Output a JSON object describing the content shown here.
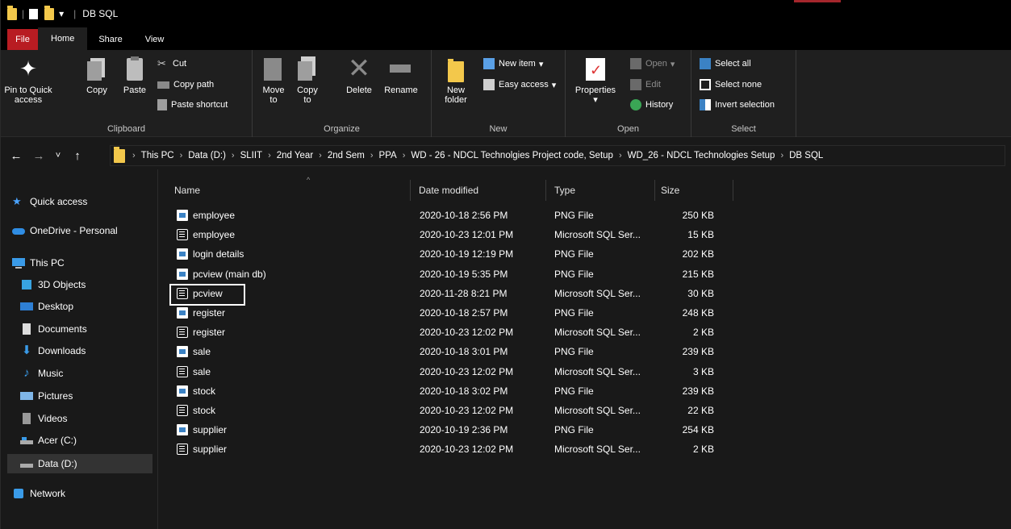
{
  "window": {
    "title": "DB SQL"
  },
  "tabs": [
    {
      "label": "File"
    },
    {
      "label": "Home"
    },
    {
      "label": "Share"
    },
    {
      "label": "View"
    }
  ],
  "ribbon": {
    "clipboard": {
      "label": "Clipboard",
      "pin": "Pin to Quick access",
      "copy": "Copy",
      "paste": "Paste",
      "cut": "Cut",
      "copy_path": "Copy path",
      "paste_shortcut": "Paste shortcut"
    },
    "organize": {
      "label": "Organize",
      "move_to": "Move to",
      "copy_to": "Copy to",
      "delete": "Delete",
      "rename": "Rename"
    },
    "new": {
      "label": "New",
      "new_folder": "New folder",
      "new_item": "New item",
      "easy_access": "Easy access"
    },
    "open": {
      "label": "Open",
      "properties": "Properties",
      "open": "Open",
      "edit": "Edit",
      "history": "History"
    },
    "select": {
      "label": "Select",
      "select_all": "Select all",
      "select_none": "Select none",
      "invert": "Invert selection"
    }
  },
  "address": {
    "crumbs": [
      "This PC",
      "Data (D:)",
      "SLIIT",
      "2nd Year",
      "2nd Sem",
      "PPA",
      "WD - 26 - NDCL Technolgies Project code, Setup",
      "WD_26 - NDCL Technologies Setup",
      "DB SQL"
    ]
  },
  "nav": [
    {
      "label": "Quick access",
      "icon": "star-icon"
    },
    {
      "label": "OneDrive - Personal",
      "icon": "cloud-icon"
    },
    {
      "label": "This PC",
      "icon": "computer-icon"
    },
    {
      "label": "3D Objects",
      "icon": "cube-icon"
    },
    {
      "label": "Desktop",
      "icon": "desktop-icon"
    },
    {
      "label": "Documents",
      "icon": "document-icon"
    },
    {
      "label": "Downloads",
      "icon": "download-icon"
    },
    {
      "label": "Music",
      "icon": "music-icon"
    },
    {
      "label": "Pictures",
      "icon": "pictures-icon"
    },
    {
      "label": "Videos",
      "icon": "video-icon"
    },
    {
      "label": "Acer (C:)",
      "icon": "drive-icon"
    },
    {
      "label": "Data (D:)",
      "icon": "drive-icon"
    },
    {
      "label": "Network",
      "icon": "network-icon"
    }
  ],
  "columns": {
    "name": "Name",
    "date": "Date modified",
    "type": "Type",
    "size": "Size"
  },
  "files": [
    {
      "name": "employee",
      "date": "2020-10-18 2:56 PM",
      "type": "PNG File",
      "size": "250 KB",
      "kind": "png"
    },
    {
      "name": "employee",
      "date": "2020-10-23 12:01 PM",
      "type": "Microsoft SQL Ser...",
      "size": "15 KB",
      "kind": "sql"
    },
    {
      "name": "login details",
      "date": "2020-10-19 12:19 PM",
      "type": "PNG File",
      "size": "202 KB",
      "kind": "png"
    },
    {
      "name": "pcview (main db)",
      "date": "2020-10-19 5:35 PM",
      "type": "PNG File",
      "size": "215 KB",
      "kind": "png"
    },
    {
      "name": "pcview",
      "date": "2020-11-28 8:21 PM",
      "type": "Microsoft SQL Ser...",
      "size": "30 KB",
      "kind": "sql"
    },
    {
      "name": "register",
      "date": "2020-10-18 2:57 PM",
      "type": "PNG File",
      "size": "248 KB",
      "kind": "png"
    },
    {
      "name": "register",
      "date": "2020-10-23 12:02 PM",
      "type": "Microsoft SQL Ser...",
      "size": "2 KB",
      "kind": "sql"
    },
    {
      "name": "sale",
      "date": "2020-10-18 3:01 PM",
      "type": "PNG File",
      "size": "239 KB",
      "kind": "png"
    },
    {
      "name": "sale",
      "date": "2020-10-23 12:02 PM",
      "type": "Microsoft SQL Ser...",
      "size": "3 KB",
      "kind": "sql"
    },
    {
      "name": "stock",
      "date": "2020-10-18 3:02 PM",
      "type": "PNG File",
      "size": "239 KB",
      "kind": "png"
    },
    {
      "name": "stock",
      "date": "2020-10-23 12:02 PM",
      "type": "Microsoft SQL Ser...",
      "size": "22 KB",
      "kind": "sql"
    },
    {
      "name": "supplier",
      "date": "2020-10-19 2:36 PM",
      "type": "PNG File",
      "size": "254 KB",
      "kind": "png"
    },
    {
      "name": "supplier",
      "date": "2020-10-23 12:02 PM",
      "type": "Microsoft SQL Ser...",
      "size": "2 KB",
      "kind": "sql"
    }
  ],
  "colors": {
    "file_tab": "#b81c22",
    "folder": "#f3c84b",
    "accent_blue": "#3b82c4"
  }
}
